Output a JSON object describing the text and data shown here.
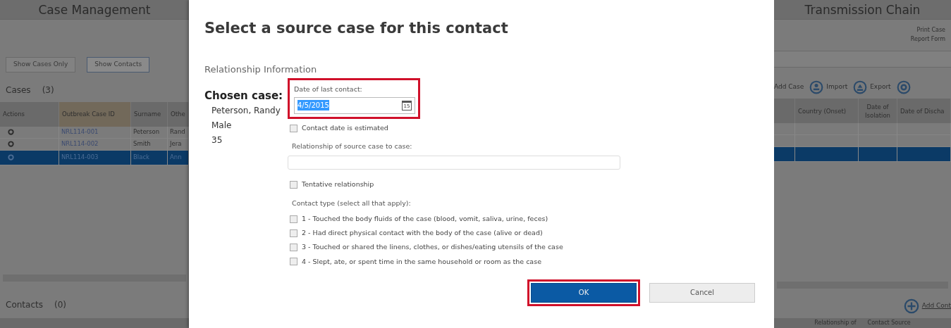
{
  "left_panel": {
    "title": "Case Management",
    "filters": [
      {
        "label": "Show Cases Only",
        "selected": false
      },
      {
        "label": "Show Contacts",
        "selected": true
      }
    ],
    "cases_heading": "Cases",
    "cases_count": "(3)",
    "columns": [
      "Actions",
      "Outbreak Case ID",
      "Surname",
      "Othe"
    ],
    "rows": [
      {
        "case_id": "NRL114-001",
        "surname": "Peterson",
        "other": "Rand",
        "selected": false
      },
      {
        "case_id": "NRL114-002",
        "surname": "Smith",
        "other": "Jera",
        "selected": false
      },
      {
        "case_id": "NRL114-003",
        "surname": "Black",
        "other": "Ann",
        "selected": true
      }
    ],
    "contacts_heading": "Contacts",
    "contacts_count": "(0)"
  },
  "dialog": {
    "title": "Select a source case for this contact",
    "section": "Relationship Information",
    "chosen_case": {
      "heading": "Chosen case:",
      "lines": [
        "Peterson, Randy",
        "Male",
        "35"
      ]
    },
    "date_field": {
      "label": "Date of last contact:",
      "value": "4/5/2015",
      "calendar_day": "15",
      "text_selected": true,
      "highlighted": true
    },
    "estimated": {
      "label": "Contact date is estimated",
      "checked": false
    },
    "relationship_field": {
      "label": "Relationship of source case to case:"
    },
    "tentative": {
      "label": "Tentative relationship",
      "checked": false
    },
    "contact_type": {
      "label": "Contact type (select all that apply):",
      "options": [
        {
          "label": "1 - Touched the body fluids of the case (blood, vomit, saliva, urine, feces)",
          "checked": false
        },
        {
          "label": "2 - Had direct physical contact with the body of the case (alive or dead)",
          "checked": false
        },
        {
          "label": "3 - Touched or shared the linens, clothes, or dishes/eating utensils of the case",
          "checked": false
        },
        {
          "label": "4 - Slept, ate, or spent time in the same household or room as the case",
          "checked": false
        }
      ]
    },
    "buttons": [
      {
        "label": "OK",
        "kind": "primary",
        "highlighted": true
      },
      {
        "label": "Cancel",
        "kind": "secondary",
        "highlighted": false
      }
    ]
  },
  "right_panel": {
    "title": "Transmission Chain",
    "links": [
      "Print Case",
      "Report Form"
    ],
    "toolbar": [
      {
        "kind": "text",
        "label": "Add Case"
      },
      {
        "kind": "import",
        "label": "Import"
      },
      {
        "kind": "export",
        "label": "Export"
      },
      {
        "kind": "settings"
      }
    ],
    "columns": [
      "Country (Onset)",
      "Date of Isolation",
      "Date of Discha"
    ],
    "add_contact": "Add Cont",
    "bottom_columns": [
      "Relationship of",
      "Contact Source"
    ]
  }
}
